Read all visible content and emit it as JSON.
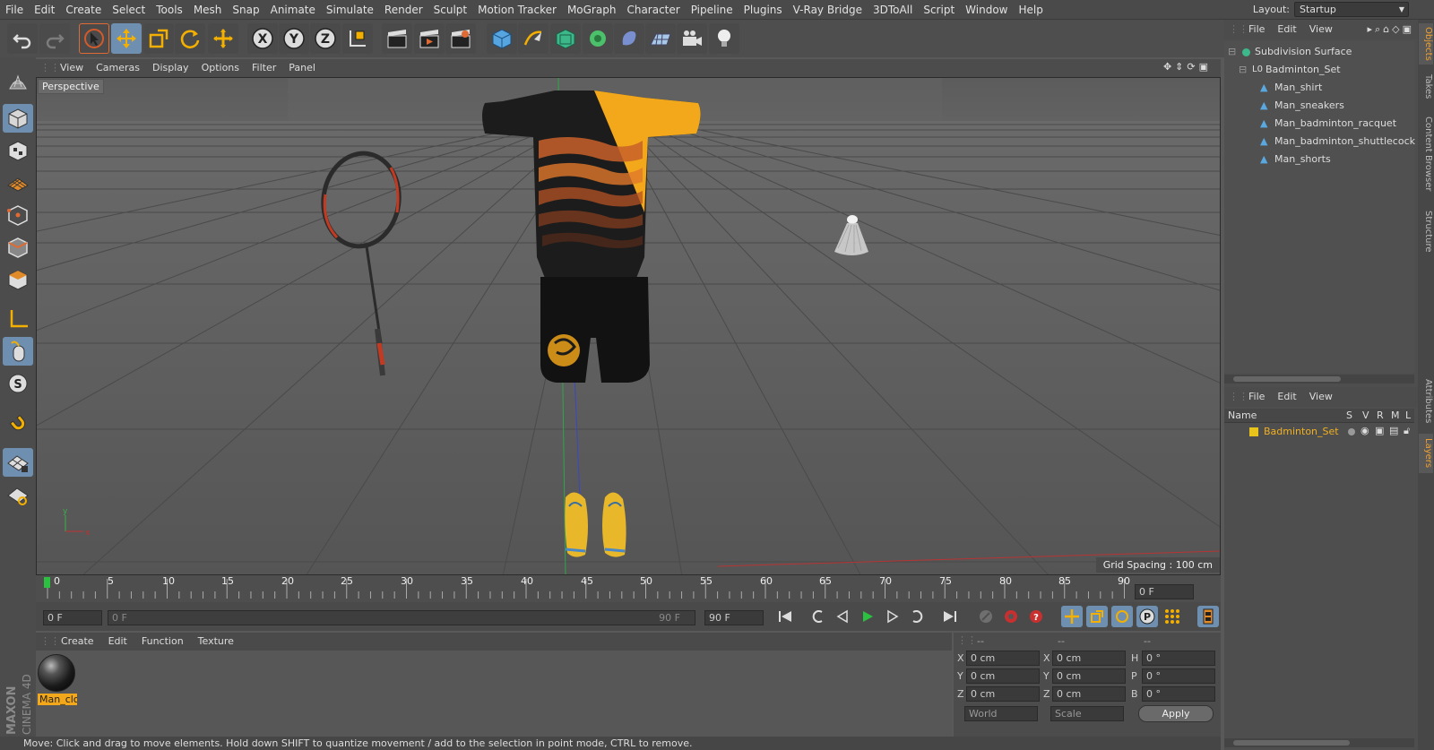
{
  "menubar": {
    "items": [
      "File",
      "Edit",
      "Create",
      "Select",
      "Tools",
      "Mesh",
      "Snap",
      "Animate",
      "Simulate",
      "Render",
      "Sculpt",
      "Motion Tracker",
      "MoGraph",
      "Character",
      "Pipeline",
      "Plugins",
      "V-Ray Bridge",
      "3DToAll",
      "Script",
      "Window",
      "Help"
    ],
    "layout_label": "Layout:",
    "layout_value": "Startup"
  },
  "viewport": {
    "menu": [
      "View",
      "Cameras",
      "Display",
      "Options",
      "Filter",
      "Panel"
    ],
    "camera_label": "Perspective",
    "grid_spacing": "Grid Spacing : 100 cm"
  },
  "timeline": {
    "ticks": [
      "0",
      "5",
      "10",
      "15",
      "20",
      "25",
      "30",
      "35",
      "40",
      "45",
      "50",
      "55",
      "60",
      "65",
      "70",
      "75",
      "80",
      "85",
      "90"
    ],
    "current_frame": "0 F",
    "start_frame": "0 F",
    "range_start": "0 F",
    "range_end": "90 F",
    "end_frame": "90 F"
  },
  "material_manager": {
    "menu": [
      "Create",
      "Edit",
      "Function",
      "Texture"
    ],
    "material_name": "Man_clc"
  },
  "coordinates": {
    "header_left": "--",
    "header_mid": "--",
    "header_right": "--",
    "rows": [
      {
        "a_label": "X",
        "a_val": "0 cm",
        "b_label": "X",
        "b_val": "0 cm",
        "c_label": "H",
        "c_val": "0 °"
      },
      {
        "a_label": "Y",
        "a_val": "0 cm",
        "b_label": "Y",
        "b_val": "0 cm",
        "c_label": "P",
        "c_val": "0 °"
      },
      {
        "a_label": "Z",
        "a_val": "0 cm",
        "b_label": "Z",
        "b_val": "0 cm",
        "c_label": "B",
        "c_val": "0 °"
      }
    ],
    "world": "World",
    "scale": "Scale",
    "apply": "Apply"
  },
  "status": "Move: Click and drag to move elements. Hold down SHIFT to quantize movement / add to the selection in point mode, CTRL to remove.",
  "object_manager": {
    "menu": [
      "File",
      "Edit",
      "View"
    ],
    "objects": [
      {
        "name": "Subdivision Surface"
      },
      {
        "name": "Badminton_Set"
      },
      {
        "name": "Man_shirt"
      },
      {
        "name": "Man_sneakers"
      },
      {
        "name": "Man_badminton_racquet"
      },
      {
        "name": "Man_badminton_shuttlecock"
      },
      {
        "name": "Man_shorts"
      }
    ]
  },
  "layer_manager": {
    "menu": [
      "File",
      "Edit",
      "View"
    ],
    "columns": [
      "Name",
      "S",
      "V",
      "R",
      "M",
      "L"
    ],
    "layer_name": "Badminton_Set",
    "layer_color": "#e8c31c"
  },
  "side_tabs": [
    "Objects",
    "Takes",
    "Content Browser",
    "Structure",
    "Attributes",
    "Layers"
  ],
  "branding": {
    "line1": "MAXON",
    "line2": "CINEMA 4D"
  }
}
